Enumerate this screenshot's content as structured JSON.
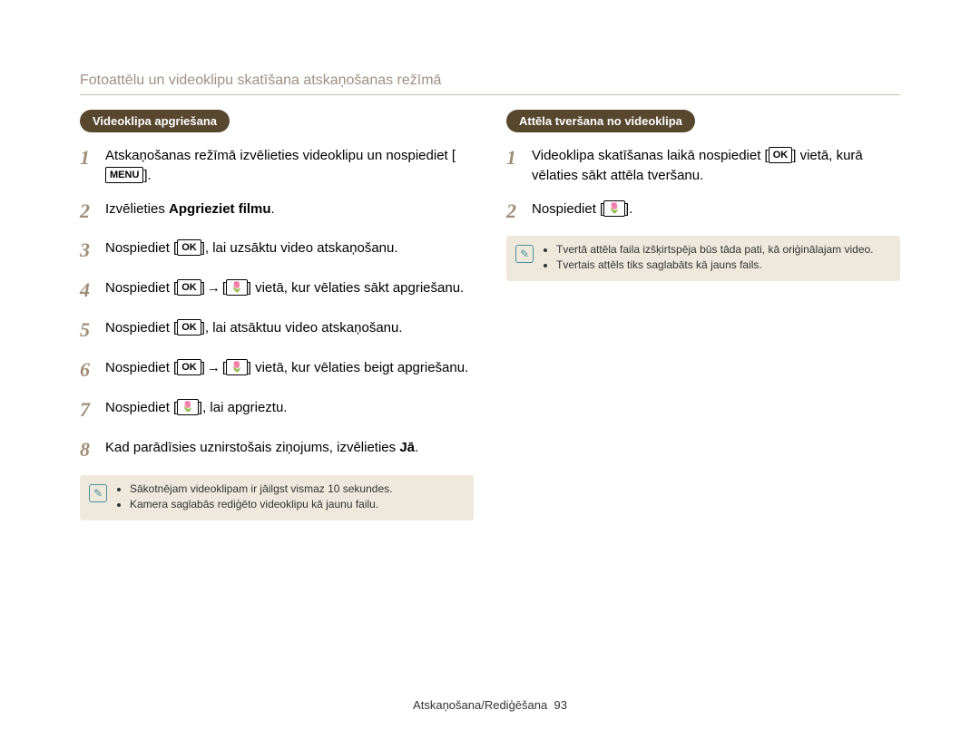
{
  "sectionTitle": "Fotoattēlu un videoklipu skatīšana atskaņošanas režīmā",
  "left": {
    "pill": "Videoklipa apgriešana",
    "steps": [
      {
        "n": "1",
        "pre": "Atskaņošanas režīmā izvēlieties videoklipu un nospiediet [",
        "key": "MENU",
        "post": "]."
      },
      {
        "n": "2",
        "pre": "Izvēlieties ",
        "bold": "Apgrieziet filmu",
        "post": "."
      },
      {
        "n": "3",
        "pre": "Nospiediet [",
        "key": "OK",
        "post": "], lai uzsāktu video atskaņošanu."
      },
      {
        "n": "4",
        "pre": "Nospiediet [",
        "key": "OK",
        "mid": "→",
        "key2": "🌷",
        "post": "] vietā, kur vēlaties sākt apgriešanu."
      },
      {
        "n": "5",
        "pre": "Nospiediet [",
        "key": "OK",
        "post": "], lai atsāktuu video atskaņošanu."
      },
      {
        "n": "6",
        "pre": "Nospiediet [",
        "key": "OK",
        "mid": "→",
        "key2": "🌷",
        "post": "] vietā, kur vēlaties beigt apgriešanu."
      },
      {
        "n": "7",
        "pre": "Nospiediet [",
        "key": "🌷",
        "post": "], lai apgrieztu."
      },
      {
        "n": "8",
        "pre": "Kad parādīsies uznirstošais ziņojums, izvēlieties ",
        "bold": "Jā",
        "post": "."
      }
    ],
    "notes": [
      "Sākotnējam videoklipam ir jāilgst vismaz 10 sekundes.",
      "Kamera saglabās rediģēto videoklipu kā jaunu failu."
    ]
  },
  "right": {
    "pill": "Attēla tveršana no videoklipa",
    "steps": [
      {
        "n": "1",
        "pre": "Videoklipa skatīšanas laikā nospiediet [",
        "key": "OK",
        "post": "] vietā, kurā vēlaties sākt attēla tveršanu."
      },
      {
        "n": "2",
        "pre": "Nospiediet [",
        "key": "🌷",
        "post": "]."
      }
    ],
    "notes": [
      "Tvertā attēla faila izšķirtspēja būs tāda pati, kā oriģinālajam video.",
      "Tvertais attēls tiks saglabāts kā jauns fails."
    ]
  },
  "footer": {
    "label": "Atskaņošana/Rediģēšana",
    "page": "93"
  },
  "icons": {
    "note": "✎",
    "flower": "🌷"
  }
}
